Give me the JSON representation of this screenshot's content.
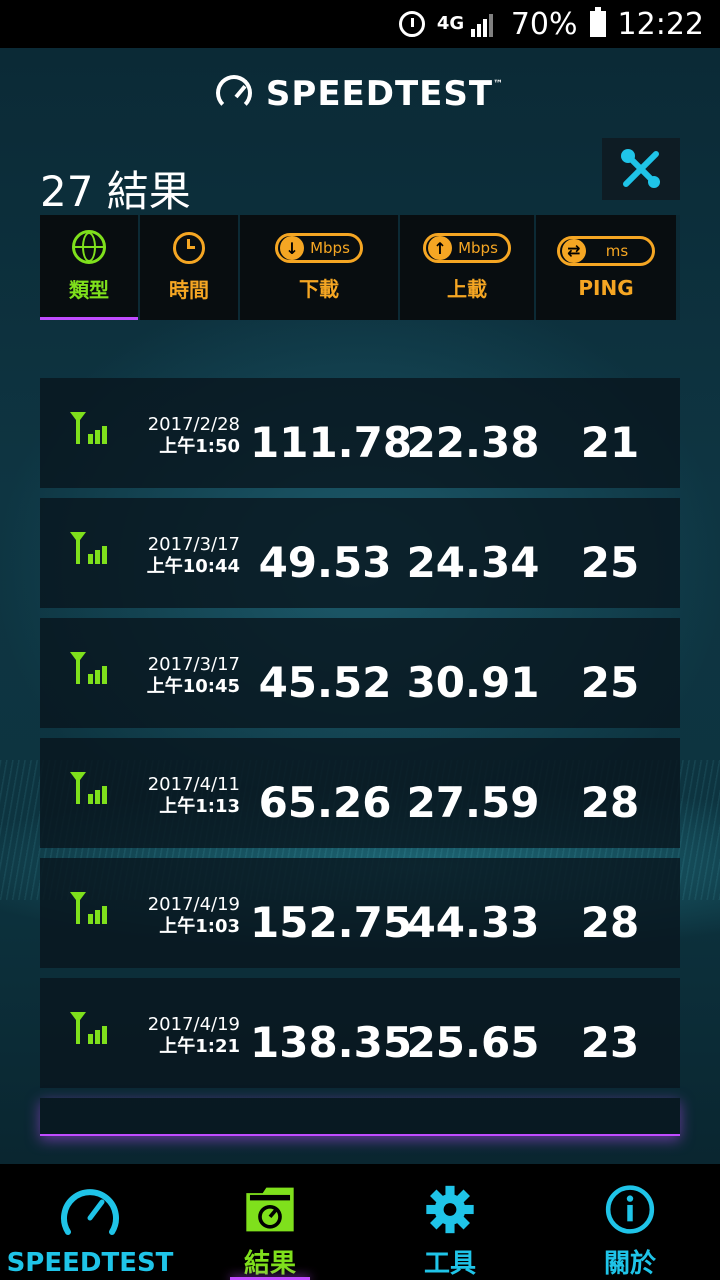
{
  "status_bar": {
    "battery": "70%",
    "time": "12:22",
    "network": "4G"
  },
  "header": {
    "app_title": "SPEEDTEST",
    "trademark": "™"
  },
  "results": {
    "count_label": "27 結果"
  },
  "columns": {
    "type": "類型",
    "time": "時間",
    "download": "下載",
    "upload": "上載",
    "ping": "PING",
    "download_unit": "Mbps",
    "upload_unit": "Mbps",
    "ping_unit": "ms"
  },
  "rows": [
    {
      "date": "2017/2/28",
      "time": "上午1:50",
      "download": "111.78",
      "upload": "22.38",
      "ping": "21"
    },
    {
      "date": "2017/3/17",
      "time": "上午10:44",
      "download": "49.53",
      "upload": "24.34",
      "ping": "25"
    },
    {
      "date": "2017/3/17",
      "time": "上午10:45",
      "download": "45.52",
      "upload": "30.91",
      "ping": "25"
    },
    {
      "date": "2017/4/11",
      "time": "上午1:13",
      "download": "65.26",
      "upload": "27.59",
      "ping": "28"
    },
    {
      "date": "2017/4/19",
      "time": "上午1:03",
      "download": "152.75",
      "upload": "44.33",
      "ping": "28"
    },
    {
      "date": "2017/4/19",
      "time": "上午1:21",
      "download": "138.35",
      "upload": "25.65",
      "ping": "23"
    }
  ],
  "nav": [
    {
      "label": "SPEEDTEST",
      "icon": "gauge-icon"
    },
    {
      "label": "結果",
      "icon": "results-folder-icon"
    },
    {
      "label": "工具",
      "icon": "gear-icon"
    },
    {
      "label": "關於",
      "icon": "info-icon"
    }
  ],
  "colors": {
    "accent_green": "#7fe01c",
    "accent_orange": "#f5a623",
    "accent_cyan": "#1fc4e8",
    "accent_purple": "#c04cff"
  }
}
